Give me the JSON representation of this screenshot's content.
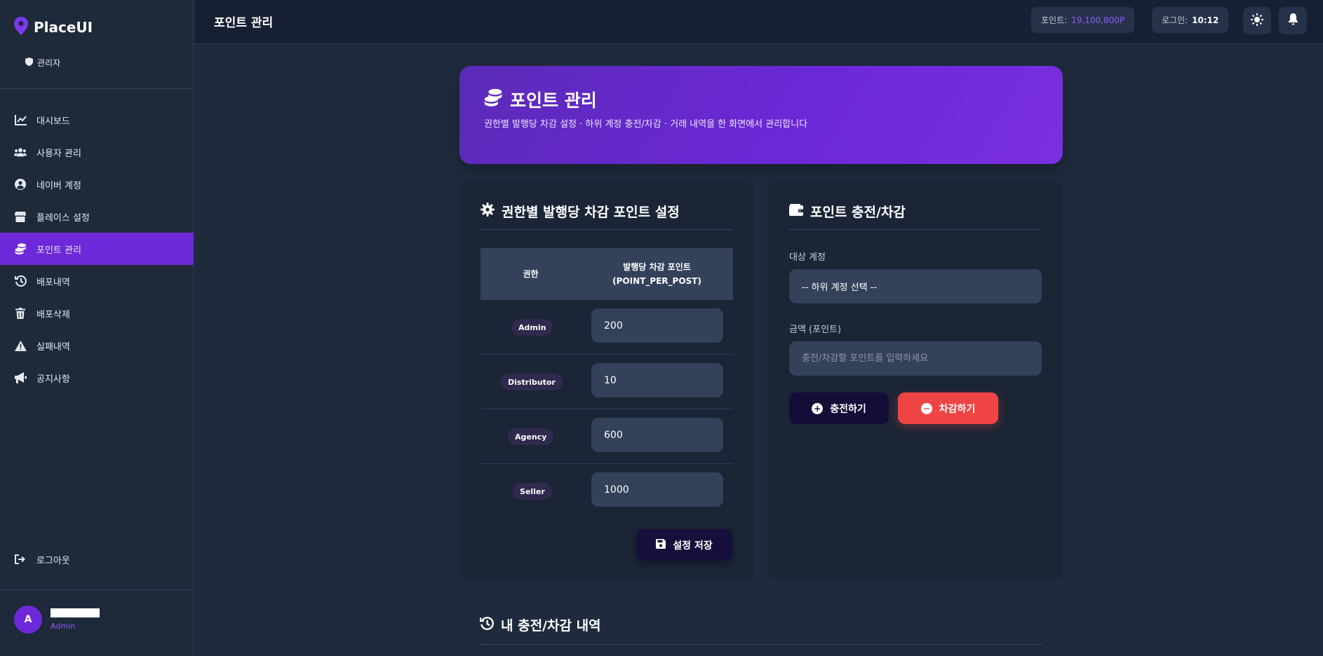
{
  "app": {
    "name": "PlaceUI",
    "role": "관리자"
  },
  "sidebar": {
    "items": [
      {
        "label": "대시보드",
        "icon": "chart-line-icon",
        "active": false
      },
      {
        "label": "사용자 관리",
        "icon": "users-icon",
        "active": false
      },
      {
        "label": "네이버 계정",
        "icon": "user-circle-icon",
        "active": false
      },
      {
        "label": "플레이스 설정",
        "icon": "store-icon",
        "active": false
      },
      {
        "label": "포인트 관리",
        "icon": "coins-icon",
        "active": true
      },
      {
        "label": "배포내역",
        "icon": "history-icon",
        "active": false
      },
      {
        "label": "배포삭제",
        "icon": "trash-icon",
        "active": false
      },
      {
        "label": "실패내역",
        "icon": "warning-icon",
        "active": false
      },
      {
        "label": "공지사항",
        "icon": "megaphone-icon",
        "active": false
      }
    ],
    "logout": "로그아웃",
    "user": {
      "avatar": "A",
      "role": "Admin"
    }
  },
  "topbar": {
    "title": "포인트 관리",
    "points_label": "포인트:",
    "points_value": "19,100,800P",
    "login_label": "로그인:",
    "login_value": "10:12"
  },
  "hero": {
    "title": "포인트 관리",
    "subtitle": "권한별 발행당 차감 설정 · 하위 계정 충전/차감 · 거래 내역을 한 화면에서 관리합니다"
  },
  "settings": {
    "title": "권한별 발행당 차감 포인트 설정",
    "col_role": "권한",
    "col_points_line1": "발행당 차감 포인트",
    "col_points_line2": "(POINT_PER_POST)",
    "rows": [
      {
        "role": "Admin",
        "value": "200"
      },
      {
        "role": "Distributor",
        "value": "10"
      },
      {
        "role": "Agency",
        "value": "600"
      },
      {
        "role": "Seller",
        "value": "1000"
      }
    ],
    "save_label": "설정 저장"
  },
  "charge": {
    "title": "포인트 충전/차감",
    "target_label": "대상 계정",
    "target_value": "-- 하위 계정 선택 --",
    "amount_label": "금액 (포인트)",
    "amount_placeholder": "충전/차감할 포인트를 입력하세요",
    "charge_label": "충전하기",
    "deduct_label": "차감하기"
  },
  "history": {
    "title": "내 충전/차감 내역"
  },
  "colors": {
    "accent": "#6d28d9",
    "points": "#8b5cf6",
    "danger": "#ef4444"
  }
}
